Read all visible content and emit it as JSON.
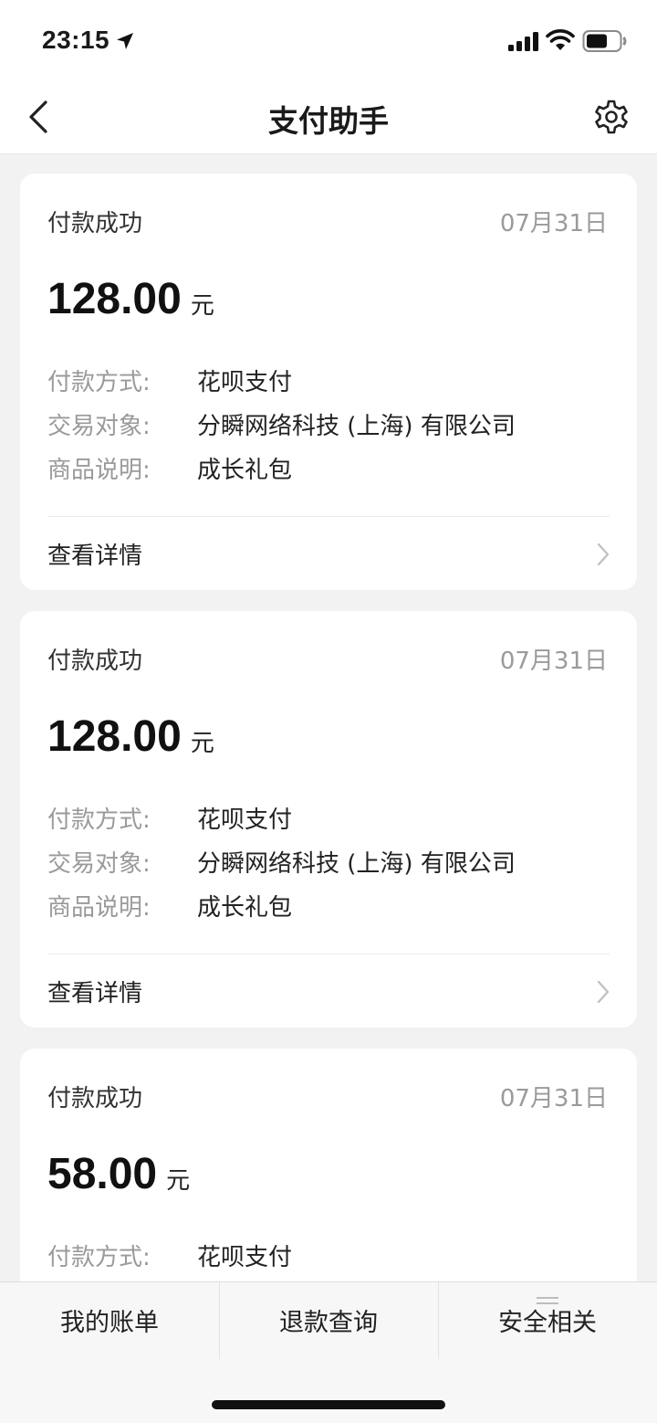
{
  "status_bar": {
    "time": "23:15",
    "icons": [
      "location-arrow-icon",
      "signal-icon",
      "wifi-icon",
      "battery-icon"
    ]
  },
  "nav": {
    "title": "支付助手",
    "back_icon": "chevron-left-icon",
    "settings_icon": "gear-icon"
  },
  "cards": [
    {
      "status": "付款成功",
      "date": "07月31日",
      "amount": "128.00",
      "unit": "元",
      "rows": [
        {
          "label": "付款方式:",
          "value": "花呗支付"
        },
        {
          "label": "交易对象:",
          "value": "分瞬网络科技 (上海) 有限公司"
        },
        {
          "label": "商品说明:",
          "value": "成长礼包"
        }
      ],
      "details_label": "查看详情"
    },
    {
      "status": "付款成功",
      "date": "07月31日",
      "amount": "128.00",
      "unit": "元",
      "rows": [
        {
          "label": "付款方式:",
          "value": "花呗支付"
        },
        {
          "label": "交易对象:",
          "value": "分瞬网络科技 (上海) 有限公司"
        },
        {
          "label": "商品说明:",
          "value": "成长礼包"
        }
      ],
      "details_label": "查看详情"
    },
    {
      "status": "付款成功",
      "date": "07月31日",
      "amount": "58.00",
      "unit": "元",
      "rows": [
        {
          "label": "付款方式:",
          "value": "花呗支付"
        }
      ]
    }
  ],
  "tabs": [
    {
      "label": "我的账单"
    },
    {
      "label": "退款查询"
    },
    {
      "label": "安全相关",
      "icon": "menu-icon"
    }
  ],
  "colors": {
    "background": "#f2f2f2",
    "card": "#ffffff",
    "muted_text": "#9a9a9a",
    "primary_text": "#1a1a1a"
  }
}
